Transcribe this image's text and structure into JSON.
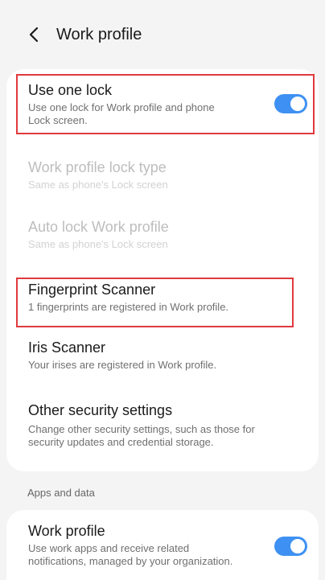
{
  "header": {
    "title": "Work profile",
    "back_icon": "chevron-left-icon"
  },
  "settings": {
    "use_one_lock": {
      "title": "Use one lock",
      "subtitle_line1": "Use one lock for Work profile and phone",
      "subtitle_line2": "Lock screen.",
      "enabled": true
    },
    "lock_type": {
      "title": "Work profile lock type",
      "subtitle": "Same as phone's Lock screen"
    },
    "auto_lock": {
      "title": "Auto lock Work profile",
      "subtitle": "Same as phone's Lock screen"
    },
    "fingerprint": {
      "title": "Fingerprint Scanner",
      "subtitle": "1 fingerprints are registered in Work profile."
    },
    "iris": {
      "title": "Iris Scanner",
      "subtitle": "Your irises are registered in Work profile."
    },
    "other_security": {
      "title": "Other security settings",
      "subtitle_line1": "Change other security settings, such as those for",
      "subtitle_line2": "security updates and credential storage."
    }
  },
  "apps_section": {
    "label": "Apps and data",
    "work_profile": {
      "title": "Work profile",
      "subtitle_line1": "Use work apps and receive related",
      "subtitle_line2": "notifications, managed by your organization.",
      "enabled": true
    }
  },
  "colors": {
    "accent": "#3e91f2",
    "highlight": "#e0393e",
    "background": "#f4f4f4",
    "card": "#ffffff"
  }
}
